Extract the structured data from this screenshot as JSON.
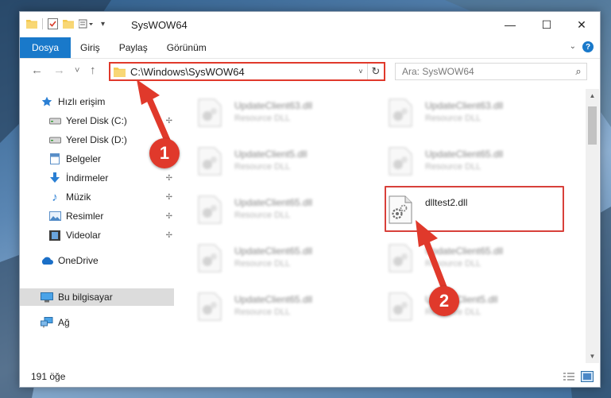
{
  "window": {
    "title": "SysWOW64",
    "controls": {
      "minimize": "—",
      "maximize": "☐",
      "close": "✕"
    }
  },
  "ribbon": {
    "tabs": [
      {
        "label": "Dosya",
        "active": true
      },
      {
        "label": "Giriş",
        "active": false
      },
      {
        "label": "Paylaş",
        "active": false
      },
      {
        "label": "Görünüm",
        "active": false
      }
    ],
    "help": "?"
  },
  "navigation": {
    "back": "←",
    "forward": "→",
    "recent": "˅",
    "up": "↑",
    "address_path": "C:\\Windows\\SysWOW64",
    "refresh": "↻",
    "search_placeholder": "Ara: SysWOW64"
  },
  "sidebar": {
    "items": [
      {
        "label": "Hızlı erişim",
        "icon": "star-icon",
        "pinned": false
      },
      {
        "label": "Yerel Disk (C:)",
        "icon": "drive-icon",
        "pinned": true
      },
      {
        "label": "Yerel Disk (D:)",
        "icon": "drive-icon",
        "pinned": false
      },
      {
        "label": "Belgeler",
        "icon": "documents-icon",
        "pinned": false
      },
      {
        "label": "İndirmeler",
        "icon": "download-icon",
        "pinned": true
      },
      {
        "label": "Müzik",
        "icon": "music-icon",
        "pinned": true
      },
      {
        "label": "Resimler",
        "icon": "pictures-icon",
        "pinned": true
      },
      {
        "label": "Videolar",
        "icon": "video-icon",
        "pinned": true
      },
      {
        "label": "OneDrive",
        "icon": "cloud-icon",
        "pinned": false
      },
      {
        "label": "Bu bilgisayar",
        "icon": "computer-icon",
        "pinned": false,
        "selected": true
      },
      {
        "label": "Ağ",
        "icon": "network-icon",
        "pinned": false
      }
    ],
    "pin_glyph": "📌"
  },
  "files": [
    {
      "name": "UpdateClient63.dll",
      "desc": "Resource DLL",
      "blurred": true
    },
    {
      "name": "UpdateClient63.dll",
      "desc": "Resource DLL",
      "blurred": true
    },
    {
      "name": "UpdateClient5.dll",
      "desc": "Resource DLL",
      "blurred": true
    },
    {
      "name": "UpdateClient65.dll",
      "desc": "Resource DLL",
      "blurred": true
    },
    {
      "name": "UpdateClient65.dll",
      "desc": "Resource DLL",
      "blurred": true
    },
    {
      "name": "dlltest2.dll",
      "desc": "",
      "blurred": false
    },
    {
      "name": "UpdateClient65.dll",
      "desc": "Resource DLL",
      "blurred": true
    },
    {
      "name": "UpdateClient65.dll",
      "desc": "Resource DLL",
      "blurred": true
    },
    {
      "name": "UpdateClient65.dll",
      "desc": "Resource DLL",
      "blurred": true
    },
    {
      "name": "UpdateClient5.dll",
      "desc": "Resource DLL",
      "blurred": true
    }
  ],
  "status": {
    "item_count": "191 öğe"
  },
  "annotations": {
    "step1": "1",
    "step2": "2"
  },
  "colors": {
    "accent": "#1979ca",
    "annotation": "#e0392b",
    "selected": "#dcdcdc"
  }
}
